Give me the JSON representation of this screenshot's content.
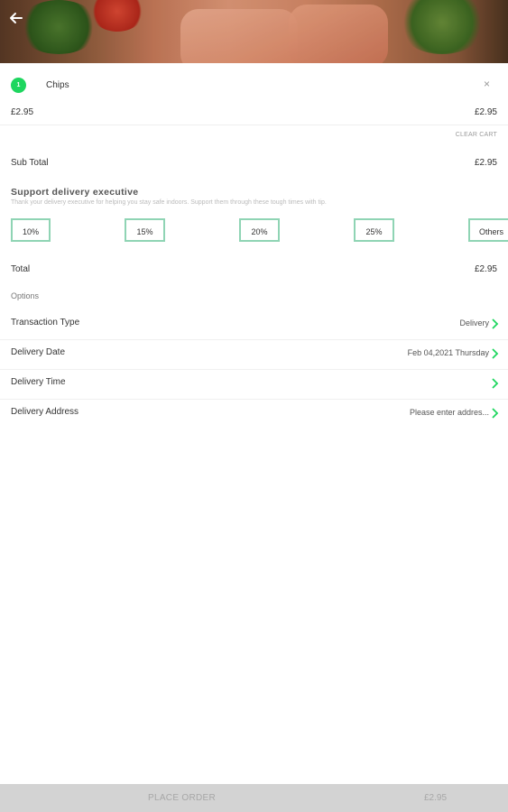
{
  "cart_item": {
    "quantity": "1",
    "name": "Chips",
    "close_symbol": "×",
    "price_left": "£2.95",
    "price_right": "£2.95"
  },
  "clear_cart_label": "CLEAR CART",
  "sub_total": {
    "label": "Sub Total",
    "value": "£2.95"
  },
  "support": {
    "title": "Support delivery executive",
    "description": "Thank your delivery executive for helping you stay safe indoors. Support them through these tough times with tip.",
    "tips": [
      "10%",
      "15%",
      "20%",
      "25%",
      "Others"
    ]
  },
  "total": {
    "label": "Total",
    "value": "£2.95"
  },
  "options_label": "Options",
  "options": [
    {
      "label": "Transaction Type",
      "value": "Delivery"
    },
    {
      "label": "Delivery Date",
      "value": "Feb 04,2021 Thursday"
    },
    {
      "label": "Delivery Time",
      "value": ""
    },
    {
      "label": "Delivery Address",
      "value": "Please enter addres..."
    }
  ],
  "bottom_bar": {
    "place_order_label": "PLACE ORDER",
    "price": "£2.95"
  },
  "colors": {
    "accent": "#1ed65f",
    "tip_border": "#8fd4b4",
    "bottom_bar": "#d3d3d3"
  },
  "icons": {
    "back": "arrow-left-icon",
    "chevron": "chevron-right-icon",
    "close": "close-icon"
  }
}
